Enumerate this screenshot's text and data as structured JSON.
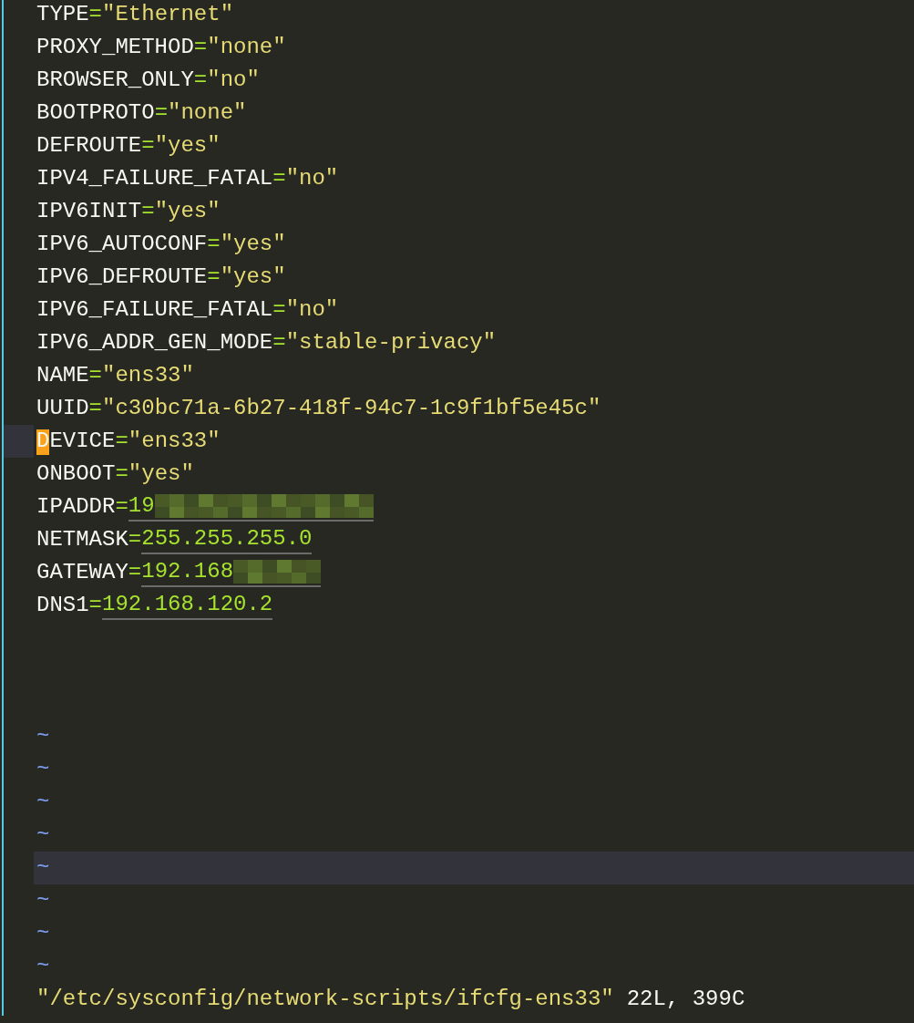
{
  "lines": [
    {
      "key": "TYPE",
      "sep": "=",
      "value": "\"Ethernet\"",
      "kind": "quoted",
      "cursor": false,
      "redacted": false
    },
    {
      "key": "PROXY_METHOD",
      "sep": "=",
      "value": "\"none\"",
      "kind": "quoted",
      "cursor": false,
      "redacted": false
    },
    {
      "key": "BROWSER_ONLY",
      "sep": "=",
      "value": "\"no\"",
      "kind": "quoted",
      "cursor": false,
      "redacted": false
    },
    {
      "key": "BOOTPROTO",
      "sep": "=",
      "value": "\"none\"",
      "kind": "quoted",
      "cursor": false,
      "redacted": false
    },
    {
      "key": "DEFROUTE",
      "sep": "=",
      "value": "\"yes\"",
      "kind": "quoted",
      "cursor": false,
      "redacted": false
    },
    {
      "key": "IPV4_FAILURE_FATAL",
      "sep": "=",
      "value": "\"no\"",
      "kind": "quoted",
      "cursor": false,
      "redacted": false
    },
    {
      "key": "IPV6INIT",
      "sep": "=",
      "value": "\"yes\"",
      "kind": "quoted",
      "cursor": false,
      "redacted": false
    },
    {
      "key": "IPV6_AUTOCONF",
      "sep": "=",
      "value": "\"yes\"",
      "kind": "quoted",
      "cursor": false,
      "redacted": false
    },
    {
      "key": "IPV6_DEFROUTE",
      "sep": "=",
      "value": "\"yes\"",
      "kind": "quoted",
      "cursor": false,
      "redacted": false
    },
    {
      "key": "IPV6_FAILURE_FATAL",
      "sep": "=",
      "value": "\"no\"",
      "kind": "quoted",
      "cursor": false,
      "redacted": false
    },
    {
      "key": "IPV6_ADDR_GEN_MODE",
      "sep": "=",
      "value": "\"stable-privacy\"",
      "kind": "quoted",
      "cursor": false,
      "redacted": false
    },
    {
      "key": "NAME",
      "sep": "=",
      "value": "\"ens33\"",
      "kind": "quoted",
      "cursor": false,
      "redacted": false
    },
    {
      "key": "UUID",
      "sep": "=",
      "value": "\"c30bc71a-6b27-418f-94c7-1c9f1bf5e45c\"",
      "kind": "quoted",
      "cursor": false,
      "redacted": false
    },
    {
      "key": "DEVICE",
      "sep": "=",
      "value": "\"ens33\"",
      "kind": "quoted",
      "cursor": true,
      "redacted": false
    },
    {
      "key": "ONBOOT",
      "sep": "=",
      "value": "\"yes\"",
      "kind": "quoted",
      "cursor": false,
      "redacted": false
    },
    {
      "key": "IPADDR",
      "sep": "=",
      "value": "19",
      "kind": "plain",
      "cursor": false,
      "redacted": true
    },
    {
      "key": "NETMASK",
      "sep": "=",
      "value": "255.255.255.0",
      "kind": "plain",
      "cursor": false,
      "redacted": false
    },
    {
      "key": "GATEWAY",
      "sep": "=",
      "value": "192.168",
      "kind": "plain",
      "cursor": false,
      "redacted": true
    },
    {
      "key": "DNS1",
      "sep": "=",
      "value": "192.168.120.2",
      "kind": "plain",
      "cursor": false,
      "redacted": false
    }
  ],
  "tildes": [
    {
      "text": "~",
      "highlighted": false
    },
    {
      "text": "~",
      "highlighted": false
    },
    {
      "text": "~",
      "highlighted": false
    },
    {
      "text": "~",
      "highlighted": false
    },
    {
      "text": "~",
      "highlighted": true
    },
    {
      "text": "~",
      "highlighted": false
    },
    {
      "text": "~",
      "highlighted": false
    },
    {
      "text": "~",
      "highlighted": false
    }
  ],
  "status_bar": {
    "file": "\"/etc/sysconfig/network-scripts/ifcfg-ens33\"",
    "info": "22L, 399C"
  }
}
